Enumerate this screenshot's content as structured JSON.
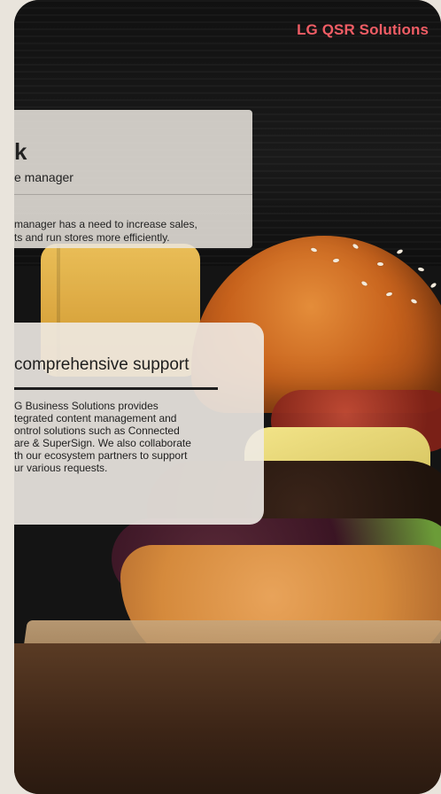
{
  "brand": {
    "label": "LG QSR Solutions"
  },
  "panel_top": {
    "title": "k",
    "subtitle": "e manager",
    "description": "manager has a need to increase sales,\nts and run stores more efficiently."
  },
  "panel_mid": {
    "heading": "comprehensive support",
    "body": "G Business Solutions provides\ntegrated content management and\nontrol solutions such as Connected\nare & SuperSign. We also collaborate\nth our ecosystem partners to support\nur various requests."
  },
  "colors": {
    "brand": "#f05d65",
    "panel": "#ebe6e0",
    "text": "#1e1e1e"
  }
}
